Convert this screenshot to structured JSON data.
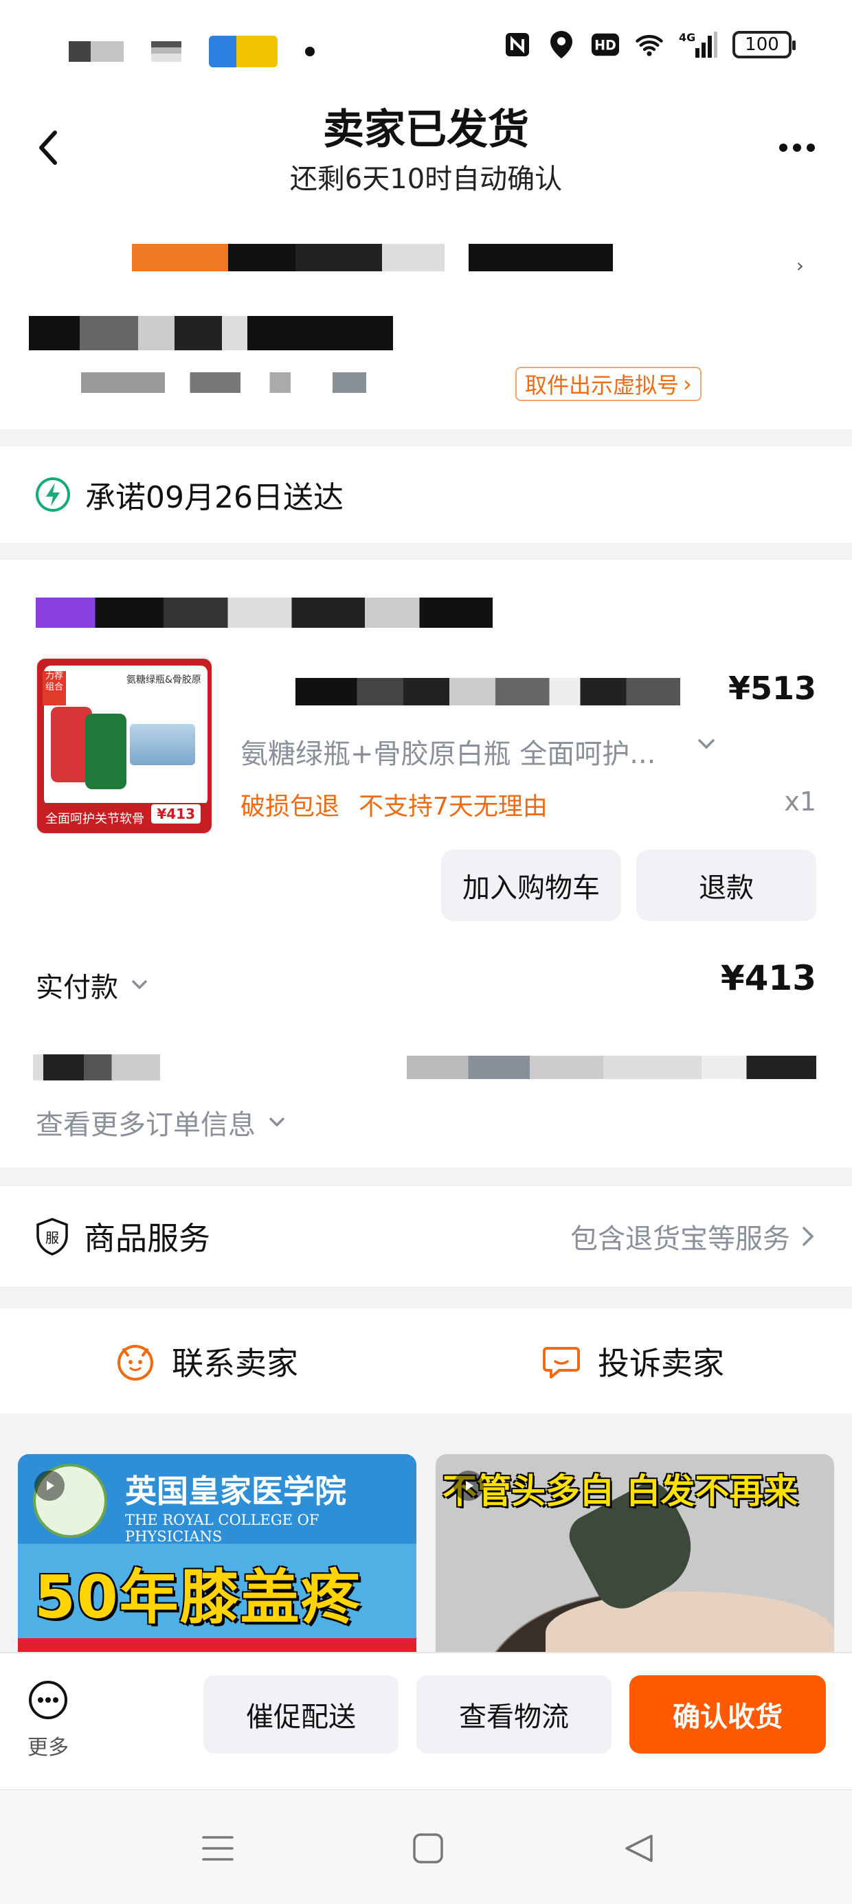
{
  "status_bar": {
    "battery": "100",
    "network": "4G",
    "hd_label": "HD"
  },
  "header": {
    "title": "卖家已发货",
    "subtitle": "还剩6天10时自动确认"
  },
  "address": {
    "virtual_number_button": "取件出示虚拟号"
  },
  "promise": {
    "text": "承诺09月26日送达"
  },
  "order": {
    "product": {
      "price": "¥513",
      "sku": "氨糖绿瓶+骨胶原白瓶 全面呵护...",
      "tags": [
        "破损包退",
        "不支持7天无理由"
      ],
      "quantity": "x1",
      "thumbnail": {
        "badge": "力荐组合",
        "heading": "氨糖绿瓶&骨胶原",
        "caption": "全面呵护关节软骨",
        "price": "¥413"
      }
    },
    "add_to_cart_button": "加入购物车",
    "refund_button": "退款",
    "paid_label": "实付款",
    "paid_amount": "¥413",
    "more_info": "查看更多订单信息"
  },
  "service": {
    "title": "商品服务",
    "detail": "包含退货宝等服务"
  },
  "contact": {
    "contact_seller": "联系卖家",
    "complain_seller": "投诉卖家"
  },
  "recommendations": [
    {
      "title_cn": "英国皇家医学院",
      "title_en": "THE ROYAL COLLEGE OF PHYSICIANS",
      "headline": "50年膝盖疼"
    },
    {
      "headline": "不管头多白 白发不再来"
    }
  ],
  "action_bar": {
    "more_label": "更多",
    "urge_delivery": "催促配送",
    "view_logistics": "查看物流",
    "confirm_receipt": "确认收货"
  },
  "colors": {
    "accent": "#ff5a00",
    "tag_orange": "#f06a12",
    "promise_green": "#19a97b",
    "muted_text": "#8a8f99"
  }
}
